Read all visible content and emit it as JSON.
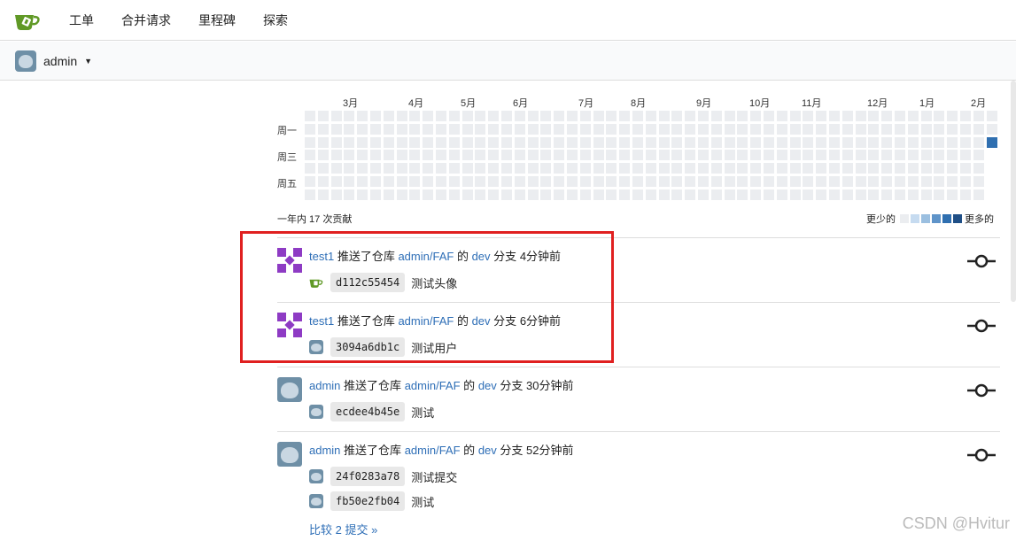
{
  "nav": {
    "items": [
      "工单",
      "合并请求",
      "里程碑",
      "探索"
    ]
  },
  "context_switcher": {
    "username": "admin"
  },
  "heatmap": {
    "months": [
      "3月",
      "4月",
      "5月",
      "6月",
      "7月",
      "8月",
      "9月",
      "10月",
      "11月",
      "12月",
      "1月",
      "2月"
    ],
    "days": [
      "周一",
      "周三",
      "周五"
    ],
    "total_text": "一年内 17 次贡献",
    "legend_less": "更少的",
    "legend_more": "更多的",
    "colors": [
      "#ebedf0",
      "#c6dbf0",
      "#9bbfe0",
      "#5f94c9",
      "#2f6fb0",
      "#1f4f86"
    ]
  },
  "feed": [
    {
      "user": "test1",
      "action": "推送了仓库",
      "repo": "admin/FAF",
      "of": "的",
      "branch": "dev",
      "branch_word": "分支",
      "time": "4分钟前",
      "avatar": "test1",
      "commits": [
        {
          "sha": "d112c55454",
          "message": "测试头像",
          "avatar": "gitea-icon"
        }
      ]
    },
    {
      "user": "test1",
      "action": "推送了仓库",
      "repo": "admin/FAF",
      "of": "的",
      "branch": "dev",
      "branch_word": "分支",
      "time": "6分钟前",
      "avatar": "test1",
      "commits": [
        {
          "sha": "3094a6db1c",
          "message": "测试用户",
          "avatar": "admin"
        }
      ]
    },
    {
      "user": "admin",
      "action": "推送了仓库",
      "repo": "admin/FAF",
      "of": "的",
      "branch": "dev",
      "branch_word": "分支",
      "time": "30分钟前",
      "avatar": "admin",
      "commits": [
        {
          "sha": "ecdee4b45e",
          "message": "测试",
          "avatar": "admin"
        }
      ]
    },
    {
      "user": "admin",
      "action": "推送了仓库",
      "repo": "admin/FAF",
      "of": "的",
      "branch": "dev",
      "branch_word": "分支",
      "time": "52分钟前",
      "avatar": "admin",
      "commits": [
        {
          "sha": "24f0283a78",
          "message": "测试提交",
          "avatar": "admin"
        },
        {
          "sha": "fb50e2fb04",
          "message": "测试",
          "avatar": "admin"
        }
      ],
      "compare": "比较 2 提交 »"
    }
  ],
  "watermark": "CSDN @Hvitur"
}
